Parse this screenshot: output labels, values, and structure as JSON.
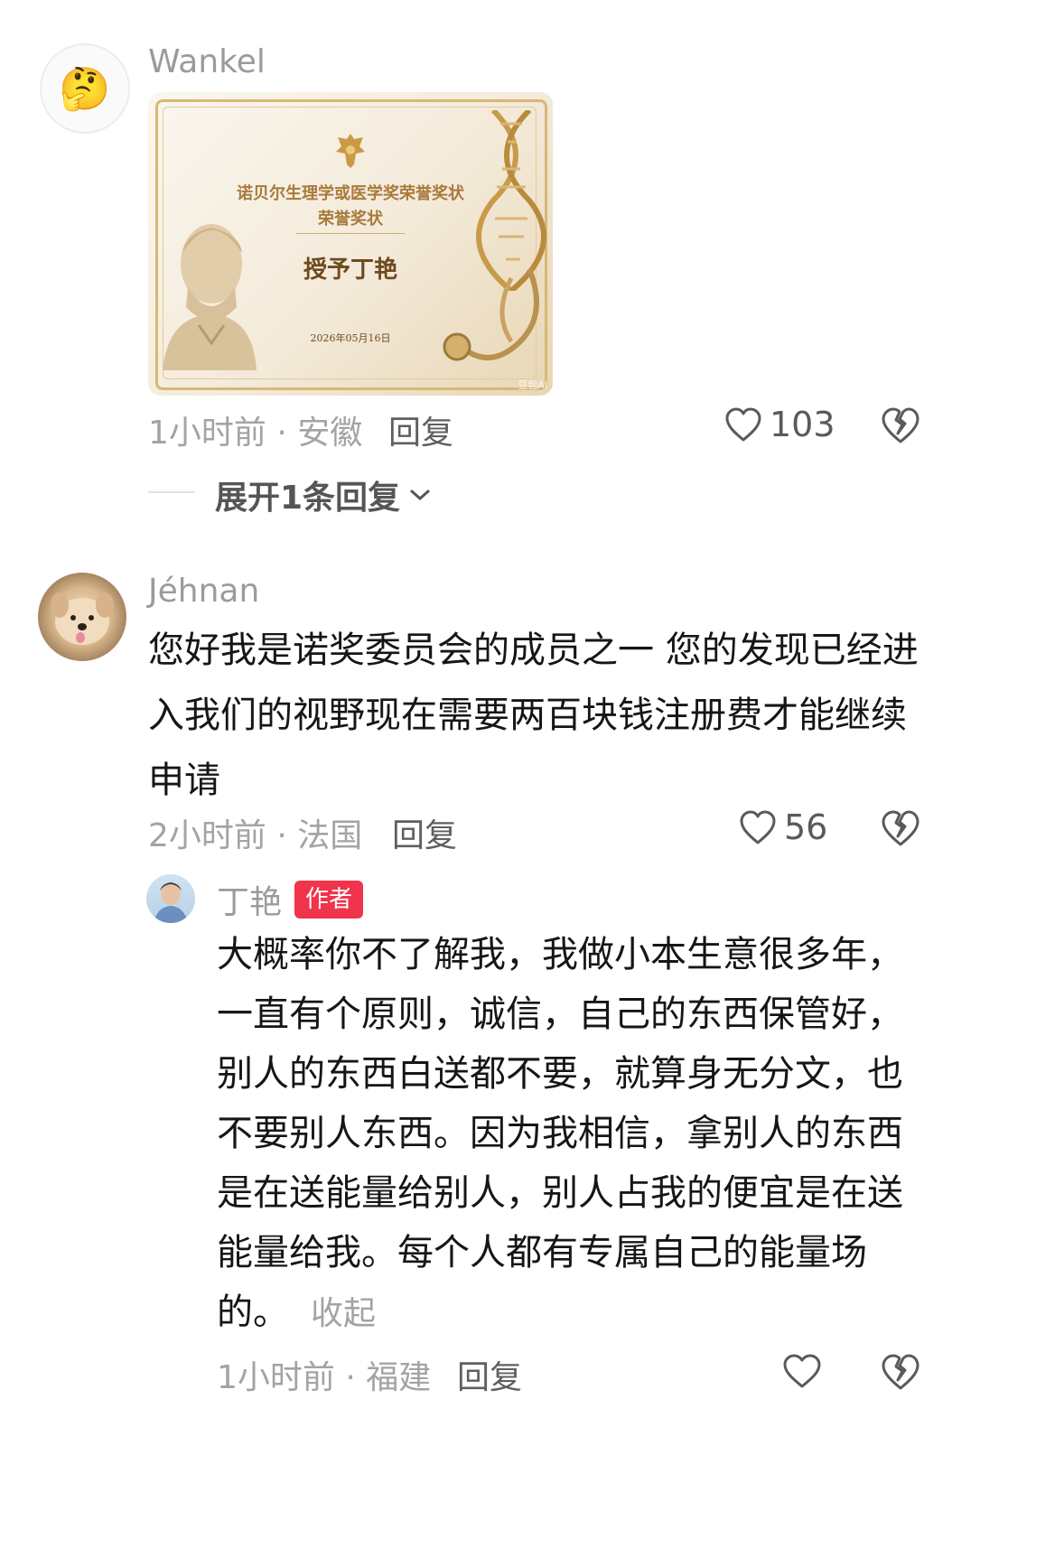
{
  "comments": [
    {
      "username": "Wankel",
      "avatar_emoji": "🤔",
      "image": {
        "title_line1": "诺贝尔生理学或医学奖荣誉奖状",
        "title_line2": "荣誉奖状",
        "awarded_to": "授予丁艳",
        "date": "2026年05月16日",
        "watermark": "豆包AI"
      },
      "meta": "1小时前 · 安徽",
      "reply_label": "回复",
      "likes": "103",
      "expand_label": "展开1条回复"
    },
    {
      "username": "Jéhnan",
      "text": "您好我是诺奖委员会的成员之一 您的发现已经进入我们的视野现在需要两百块钱注册费才能继续申请",
      "meta": "2小时前 · 法国",
      "reply_label": "回复",
      "likes": "56",
      "reply": {
        "username": "丁艳",
        "badge": "作者",
        "text": "大概率你不了解我，我做小本生意很多年，一直有个原则，诚信，自己的东西保管好，别人的东西白送都不要，就算身无分文，也不要别人东西。因为我相信，拿别人的东西是在送能量给别人，别人占我的便宜是在送能量给我。每个人都有专属自己的能量场的。",
        "collapse_label": "收起",
        "meta": "1小时前 · 福建",
        "reply_label": "回复"
      }
    }
  ],
  "colors": {
    "background": "#ffffff",
    "badge": "#f0344b",
    "muted": "#a3a3a3"
  },
  "icons": [
    "thinking-face-icon",
    "heart-icon",
    "broken-heart-icon",
    "chevron-down-icon"
  ]
}
